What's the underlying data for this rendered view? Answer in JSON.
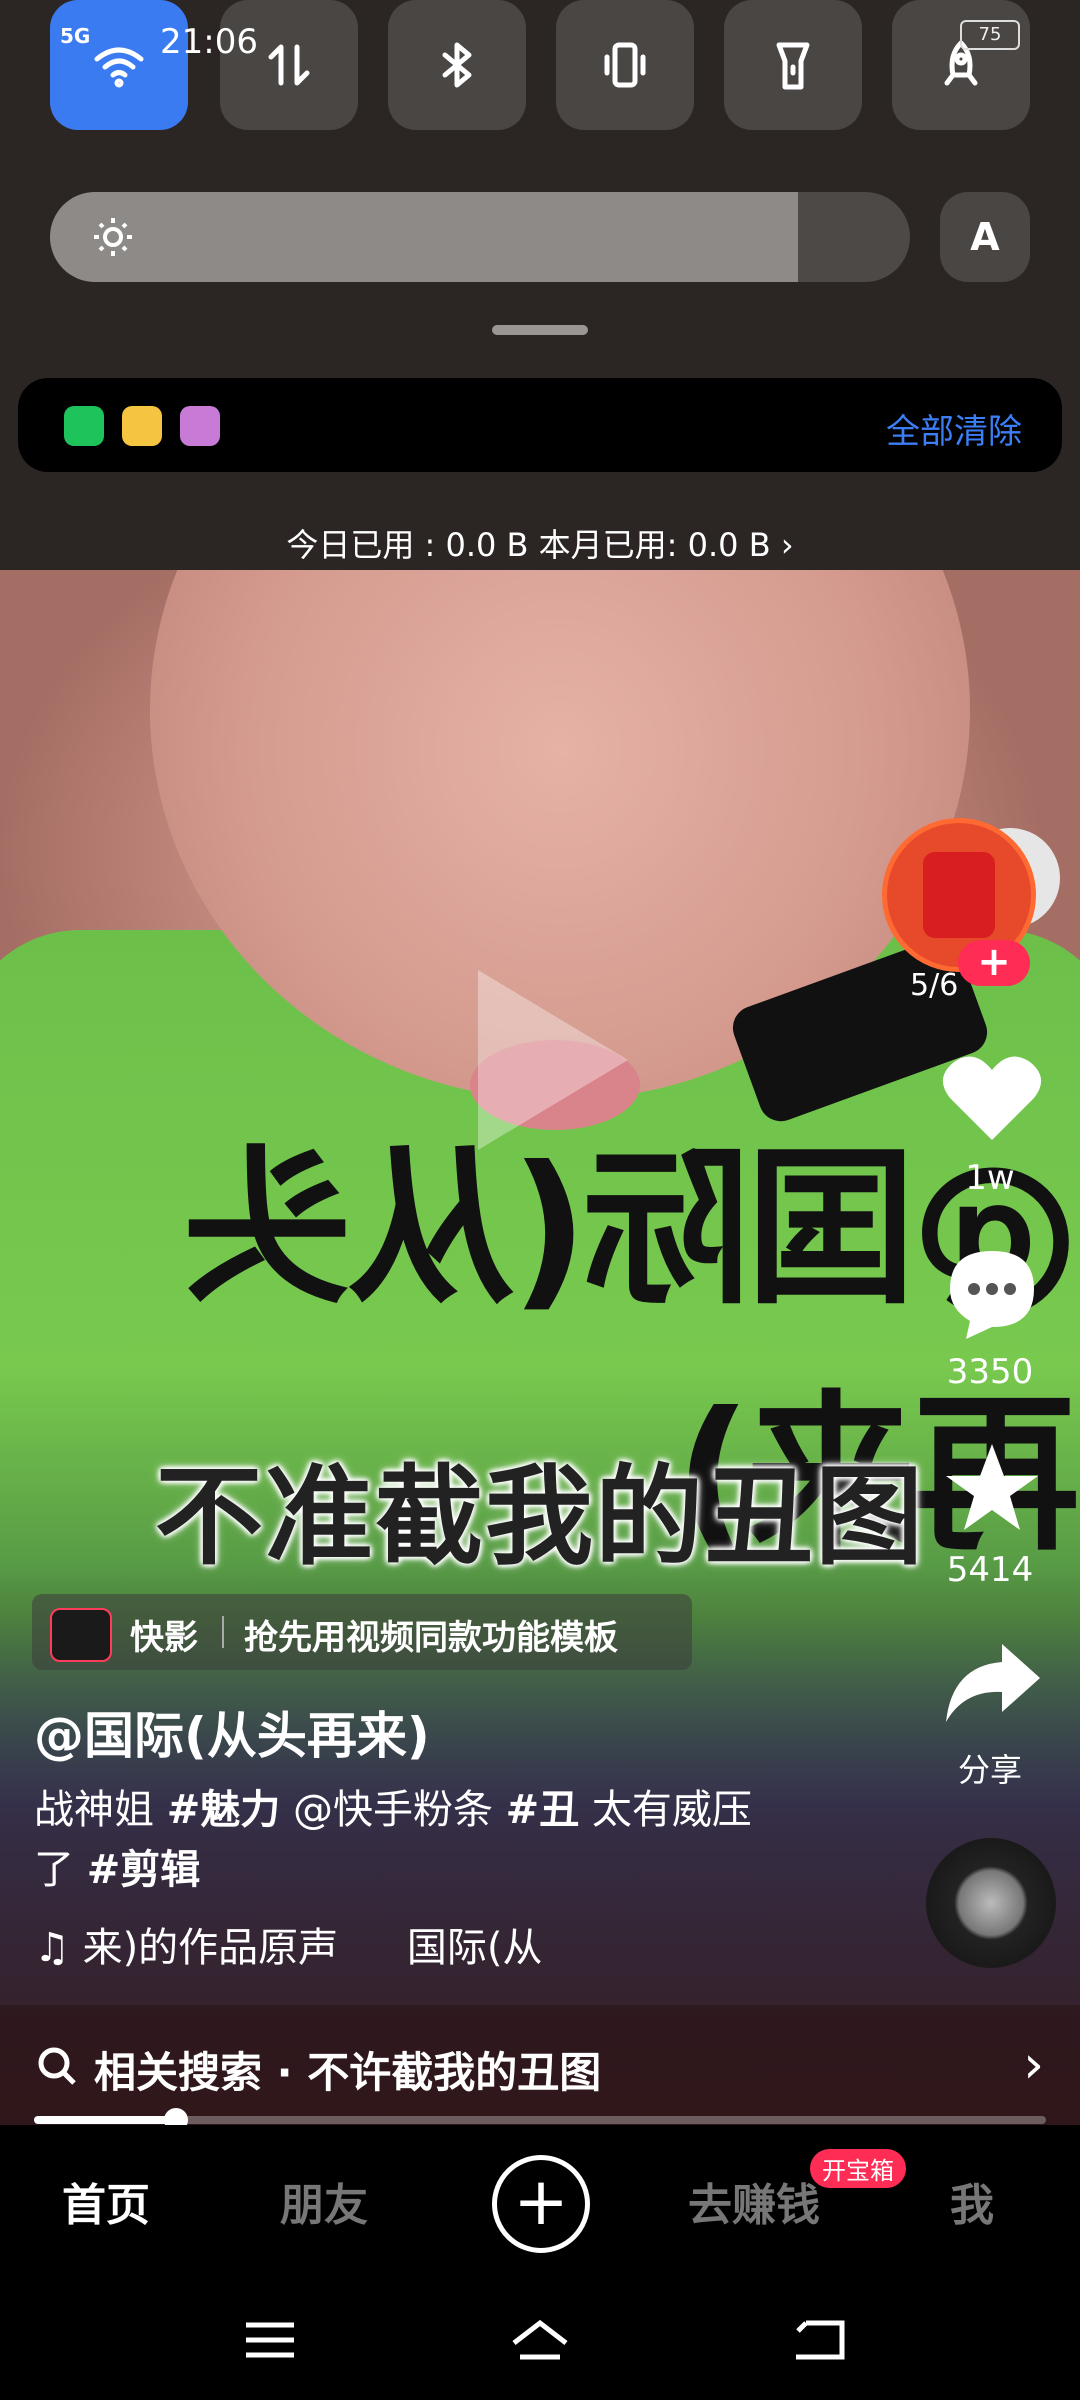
{
  "status": {
    "time": "21:06",
    "network": "5G",
    "battery": "75"
  },
  "quick_settings": {
    "tiles": [
      "wifi-icon",
      "data-transfer-icon",
      "bluetooth-icon",
      "vibrate-icon",
      "flashlight-icon",
      "rocket-icon"
    ],
    "brightness_level": 0.87,
    "auto_label": "A"
  },
  "notifications": {
    "apps": [
      "wechat-icon",
      "app2-icon",
      "app3-icon"
    ],
    "clear_all": "全部清除"
  },
  "data_usage": "今日已用 : 0.0 B 本月已用: 0.0 B",
  "video": {
    "caption": "不准截我的丑图",
    "overlay_graphic_text": "@国际(从头再来)"
  },
  "rail": {
    "red_packet_count": "5/6",
    "likes": "1w",
    "comments": "3350",
    "favorites": "5414",
    "share_label": "分享"
  },
  "template": {
    "app_name": "快影",
    "text": "抢先用视频同款功能模板"
  },
  "post": {
    "author": "@国际(从头再来)",
    "desc_line1_a": "战神姐 ",
    "desc_tag1": "#魅力",
    "desc_line1_b": " @快手粉条 ",
    "desc_tag2": "#丑",
    "desc_line1_c": " 太有威压",
    "desc_line2_a": "了 ",
    "desc_tag3": "#剪辑",
    "music": "来)的作品原声",
    "music_author": "国际(从",
    "search": "相关搜索 · 不许截我的丑图",
    "progress": 0.14
  },
  "nav": {
    "home": "首页",
    "friends": "朋友",
    "earn": "去赚钱",
    "earn_badge": "开宝箱",
    "me": "我"
  }
}
